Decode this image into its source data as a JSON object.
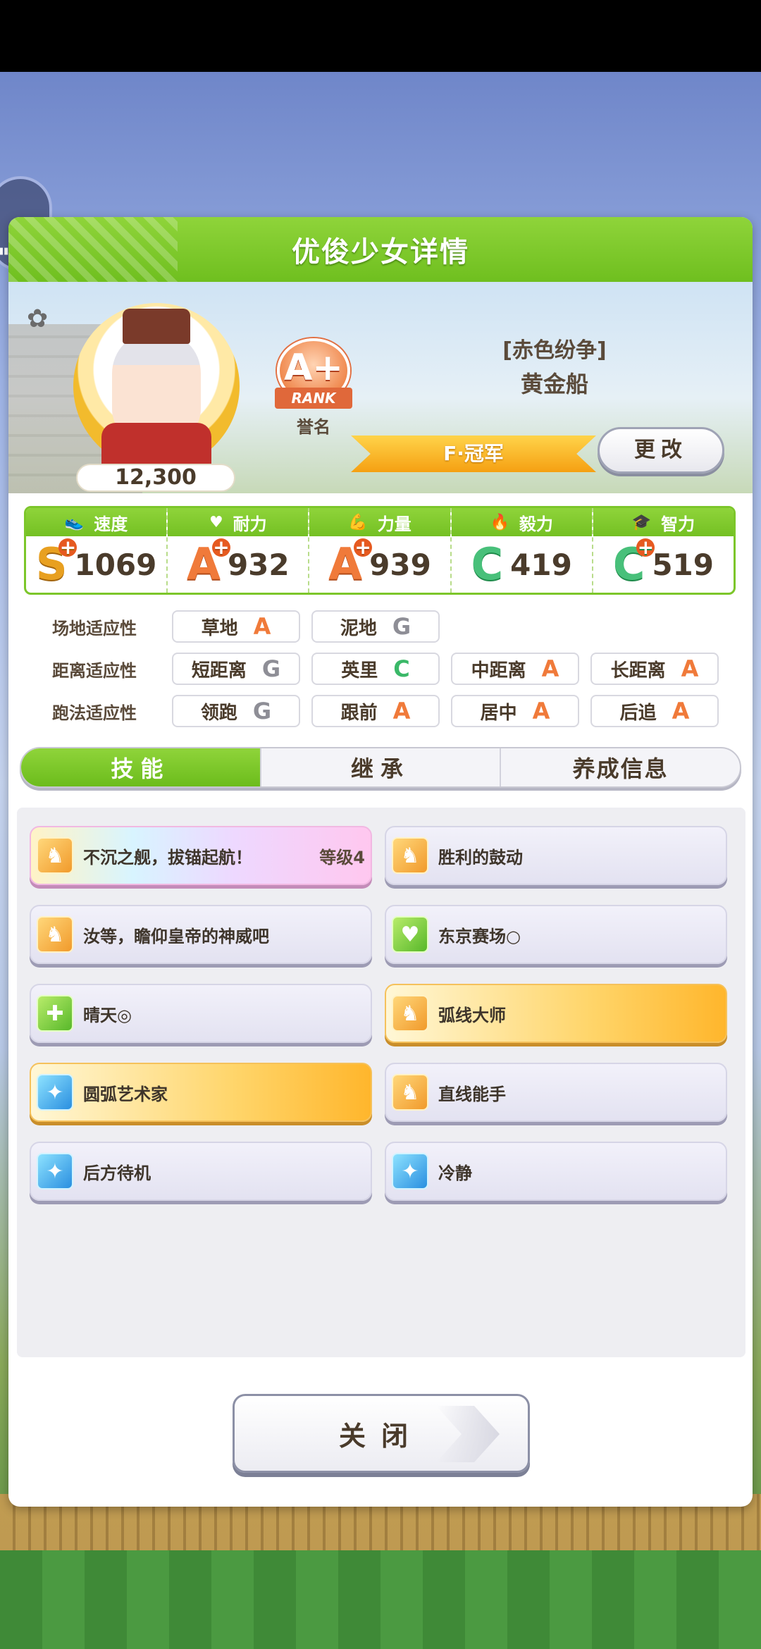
{
  "dialog": {
    "title": "优俊少女详情"
  },
  "profile": {
    "fans": "12,300",
    "rank_grade": "A+",
    "rank_ribbon": "RANK",
    "rank_label": "誉名",
    "epithet": "[赤色纷争]",
    "name": "黄金船",
    "title_ribbon": "F·冠军",
    "change_button": "更改"
  },
  "stats": [
    {
      "label": "速度",
      "icon": "shoe-icon",
      "grade": "S",
      "plus": true,
      "value": "1069"
    },
    {
      "label": "耐力",
      "icon": "heart-icon",
      "grade": "A",
      "plus": true,
      "value": "932"
    },
    {
      "label": "力量",
      "icon": "muscle-icon",
      "grade": "A",
      "plus": true,
      "value": "939"
    },
    {
      "label": "毅力",
      "icon": "flame-icon",
      "grade": "C",
      "plus": false,
      "value": "419"
    },
    {
      "label": "智力",
      "icon": "graduation-cap-icon",
      "grade": "C",
      "plus": true,
      "value": "519"
    }
  ],
  "aptitude": {
    "track": {
      "label": "场地适应性",
      "items": [
        {
          "name": "草地",
          "grade": "A"
        },
        {
          "name": "泥地",
          "grade": "G"
        }
      ]
    },
    "distance": {
      "label": "距离适应性",
      "items": [
        {
          "name": "短距离",
          "grade": "G"
        },
        {
          "name": "英里",
          "grade": "C"
        },
        {
          "name": "中距离",
          "grade": "A"
        },
        {
          "name": "长距离",
          "grade": "A"
        }
      ]
    },
    "style": {
      "label": "跑法适应性",
      "items": [
        {
          "name": "领跑",
          "grade": "G"
        },
        {
          "name": "跟前",
          "grade": "A"
        },
        {
          "name": "居中",
          "grade": "A"
        },
        {
          "name": "后追",
          "grade": "A"
        }
      ]
    }
  },
  "tabs": [
    {
      "label": "技能",
      "active": true
    },
    {
      "label": "继承",
      "active": false
    },
    {
      "label": "养成信息",
      "active": false
    }
  ],
  "skills": [
    {
      "name": "不沉之舰，拔锚起航！",
      "level": "等级4",
      "style": "rainbow",
      "icon": "speed-skill-icon"
    },
    {
      "name": "胜利的鼓动",
      "style": "normal",
      "icon": "speed-skill-icon"
    },
    {
      "name": "汝等，瞻仰皇帝的神威吧",
      "style": "normal",
      "icon": "speed-skill-icon"
    },
    {
      "name": "东京赛场○",
      "style": "normal",
      "icon": "stamina-skill-icon"
    },
    {
      "name": "晴天◎",
      "style": "normal",
      "icon": "recovery-skill-icon"
    },
    {
      "name": "弧线大师",
      "style": "gold",
      "icon": "speed-skill-icon"
    },
    {
      "name": "圆弧艺术家",
      "style": "gold",
      "icon": "sparkle-skill-icon"
    },
    {
      "name": "直线能手",
      "style": "normal",
      "icon": "speed-skill-icon"
    },
    {
      "name": "后方待机",
      "style": "normal",
      "icon": "sparkle-skill-icon"
    },
    {
      "name": "冷静",
      "style": "normal",
      "icon": "sparkle-skill-icon"
    }
  ],
  "close_button": "关闭",
  "colors": {
    "header_green": "#7cc62a",
    "grade_A": "#f07a3a",
    "grade_C": "#3ab868",
    "grade_G": "#8e8e96"
  }
}
